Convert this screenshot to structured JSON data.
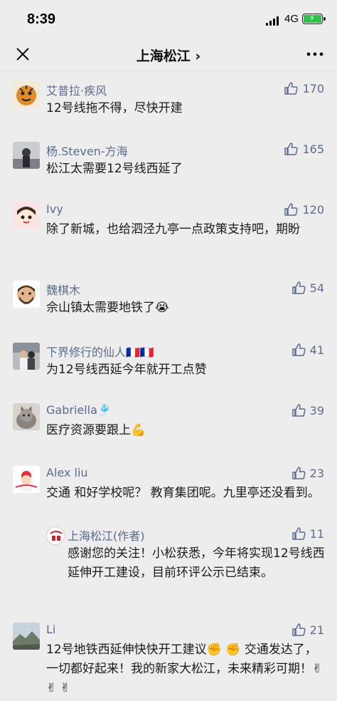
{
  "status_bar": {
    "time": "8:39",
    "network": "4G"
  },
  "nav": {
    "title": "上海松江 ›"
  },
  "comments": [
    {
      "name": "艾普拉·疾风",
      "likes": "170",
      "text": "12号线拖不得，尽快开建"
    },
    {
      "name": "杨.Steven-方海",
      "likes": "165",
      "text": "松江太需要12号线西延了"
    },
    {
      "name": "Ivy",
      "likes": "120",
      "text": "除了新城，也给泗泾九亭一点政策支持吧，期盼"
    },
    {
      "name": "魏棋木",
      "likes": "54",
      "text": "佘山镇太需要地铁了😭"
    },
    {
      "name": "下界修行的仙人🇫🇷🇫🇷",
      "likes": "41",
      "text": "为12号线西延今年就开工点赞"
    },
    {
      "name": "Gabriella🎐",
      "likes": "39",
      "text": "医疗资源要跟上💪"
    },
    {
      "name": "Alex liu",
      "likes": "23",
      "text": "交通 和好学校呢？ 教育集团呢。九里亭还没看到。"
    },
    {
      "name": "Li",
      "likes": "21",
      "text": "12号地铁西延伸快快开工建议✊ ✊ 交通发达了，一切都好起来！我的新家大松江，未来精彩可期！✌ ✌ ✌"
    }
  ],
  "reply": {
    "name": "上海松江(作者)",
    "likes": "11",
    "text": "感谢您的关注！小松获悉，今年将实现12号线西延伸开工建设，目前环评公示已结束。"
  },
  "colors": {
    "background": "#ededed",
    "name": "#5b6b8c",
    "text": "#1a1a1a",
    "battery": "#2fc24a"
  },
  "icons": [
    "close-icon",
    "more-icon",
    "thumbs-up-icon",
    "signal-icon",
    "battery-icon"
  ]
}
